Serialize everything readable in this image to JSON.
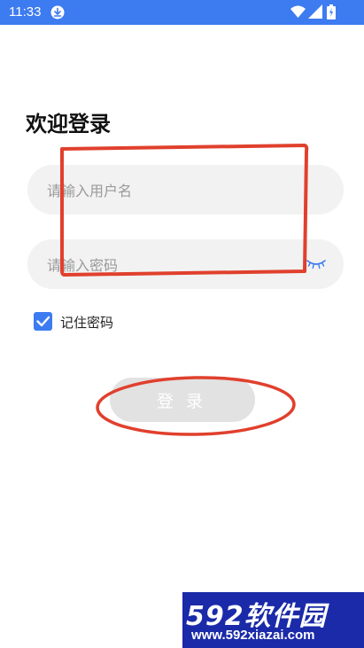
{
  "status_bar": {
    "time": "11:33",
    "icons": [
      "download-icon",
      "wifi-icon",
      "signal-icon",
      "battery-charging-icon"
    ],
    "color": "#3d7bf0"
  },
  "login": {
    "title": "欢迎登录",
    "username_placeholder": "请输入用户名",
    "password_placeholder": "请输入密码",
    "password_toggle_icon": "eye-closed-icon",
    "remember_label": "记住密码",
    "remember_checked": true,
    "login_button": "登录",
    "accent": "#3d7bf0",
    "field_background": "#f2f2f2",
    "button_background": "#e2e2e2"
  },
  "annotations": {
    "color": "#e0402d"
  },
  "watermark": {
    "brand": "592软件园",
    "url": "www.592xiazai.com"
  }
}
